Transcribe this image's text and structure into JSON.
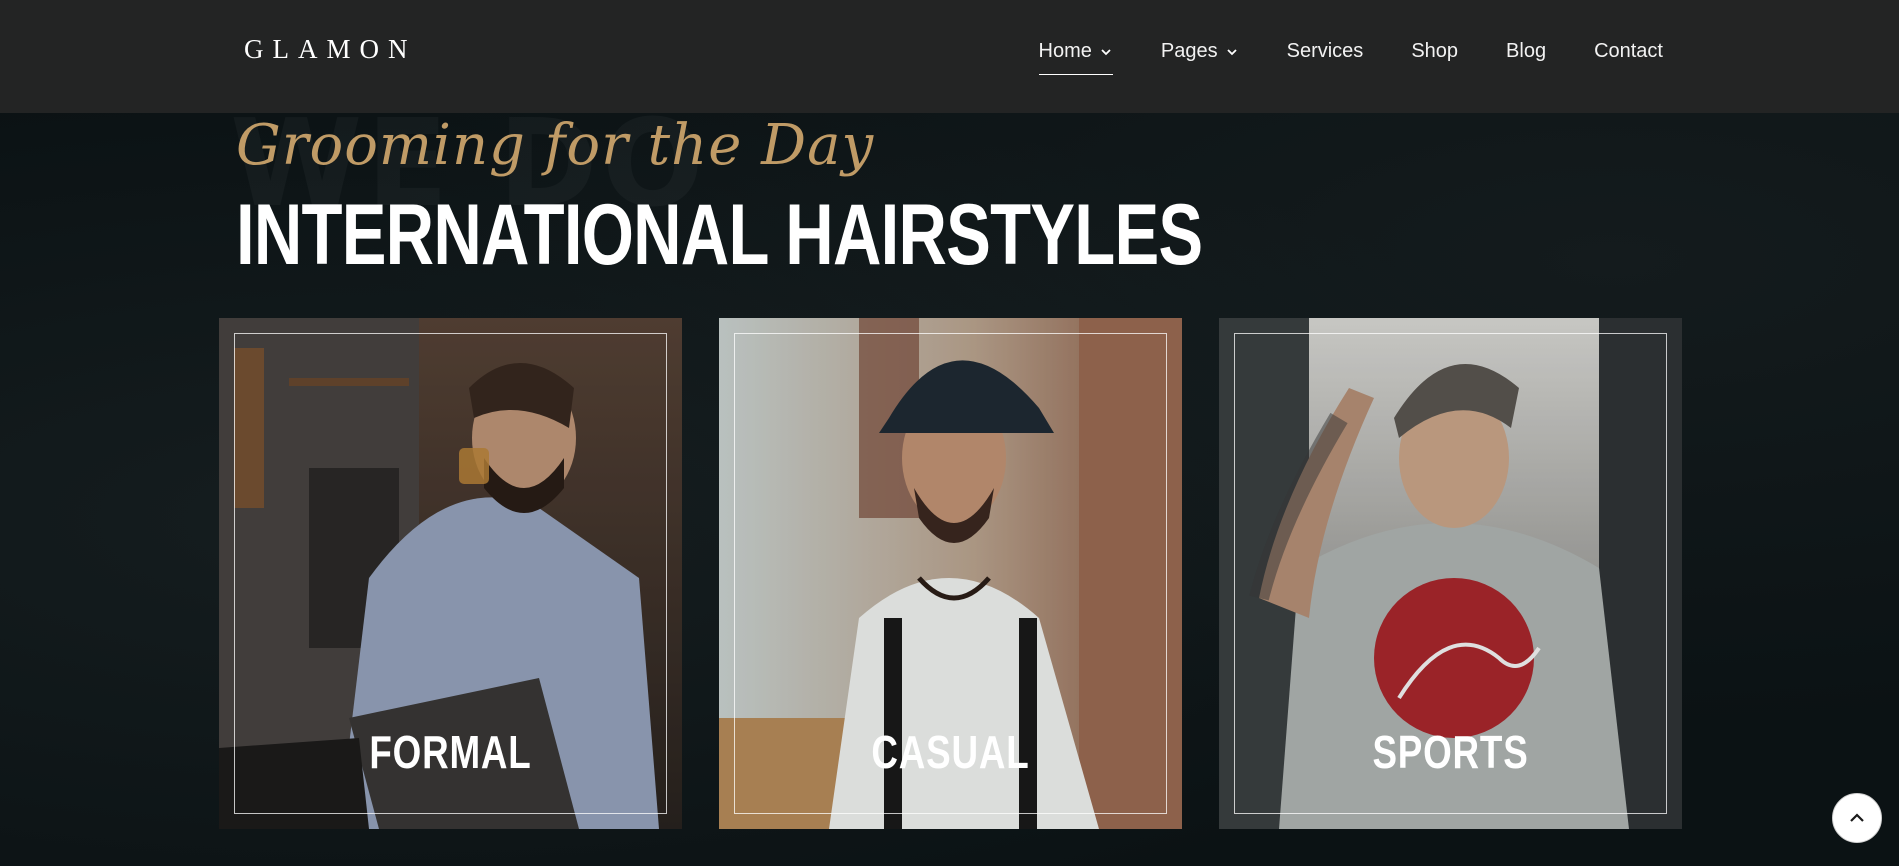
{
  "brand": {
    "logo": "GLAMON"
  },
  "nav": {
    "items": [
      {
        "label": "Home",
        "dropdown": true,
        "active": true
      },
      {
        "label": "Pages",
        "dropdown": true,
        "active": false
      },
      {
        "label": "Services",
        "dropdown": false,
        "active": false
      },
      {
        "label": "Shop",
        "dropdown": false,
        "active": false
      },
      {
        "label": "Blog",
        "dropdown": false,
        "active": false
      },
      {
        "label": "Contact",
        "dropdown": false,
        "active": false
      }
    ]
  },
  "hero": {
    "subtitle": "Grooming for the Day",
    "title": "INTERNATIONAL HAIRSTYLES"
  },
  "cards": [
    {
      "label": "FORMAL",
      "icon": "photo-formal"
    },
    {
      "label": "CASUAL",
      "icon": "photo-casual"
    },
    {
      "label": "SPORTS",
      "icon": "photo-sports"
    }
  ],
  "colors": {
    "header_bg": "#232424",
    "page_bg": "#0b1214",
    "accent_gold": "#c09b66",
    "text_white": "#ffffff"
  },
  "back_to_top": {
    "icon": "chevron-up-icon"
  }
}
